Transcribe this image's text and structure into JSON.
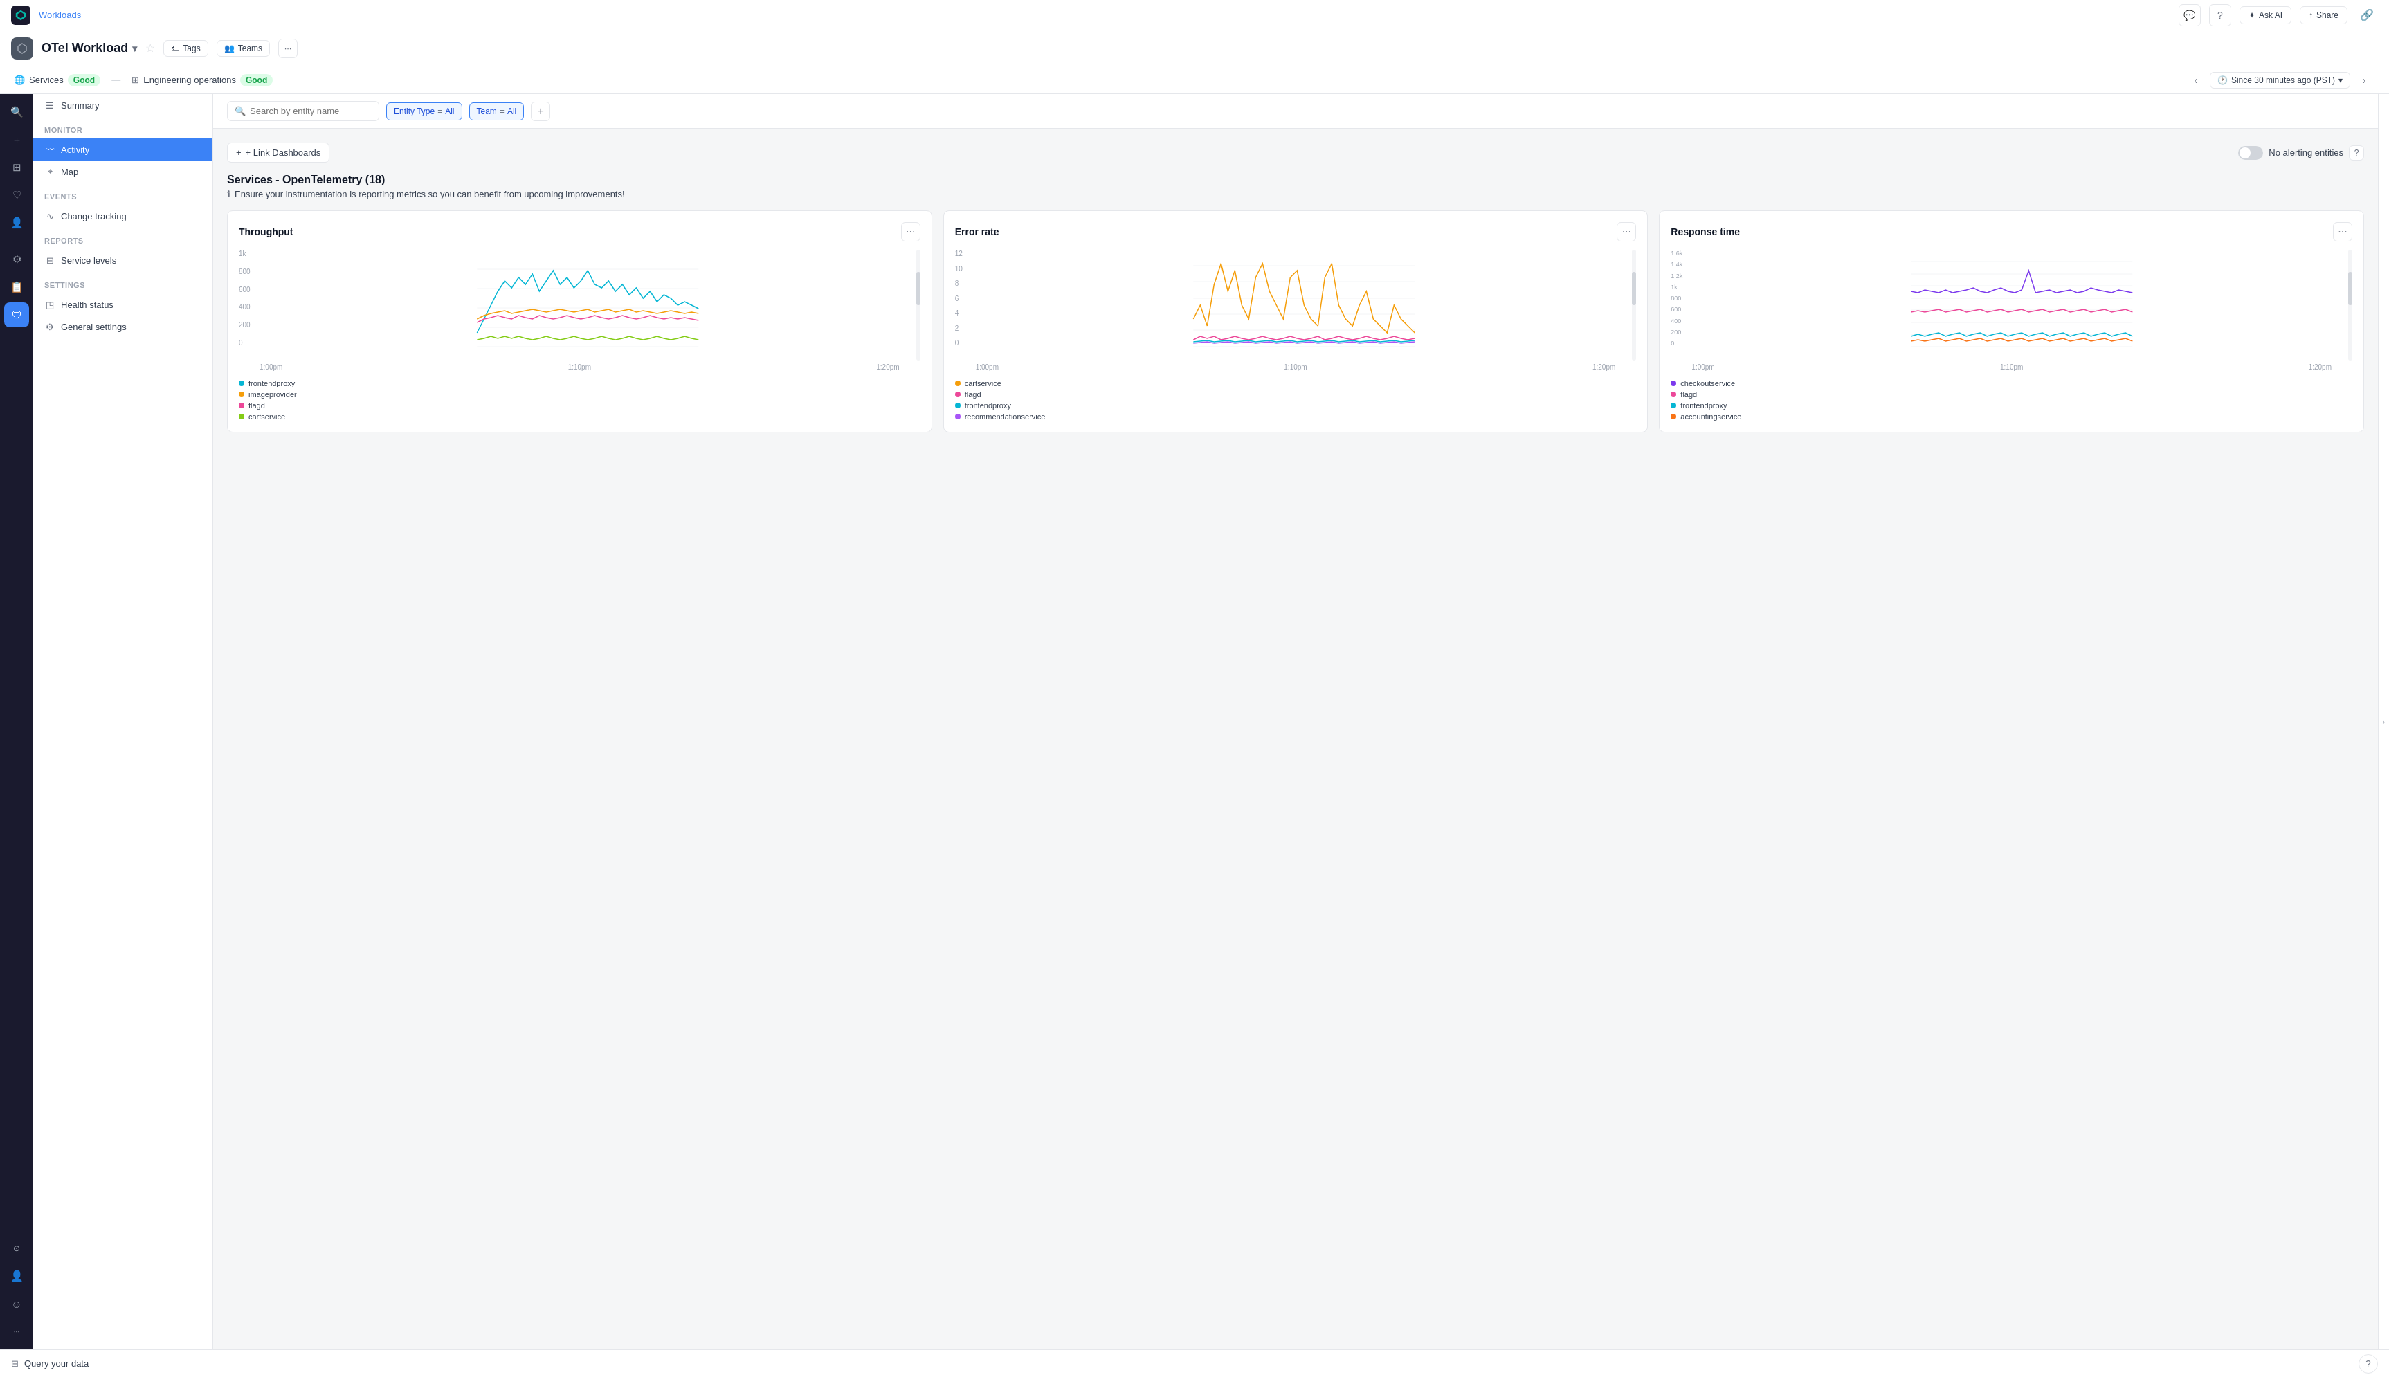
{
  "app": {
    "logo_alt": "New Relic",
    "workloads_label": "Workloads"
  },
  "topbar": {
    "chat_icon": "💬",
    "help_icon": "?",
    "ask_ai_label": "Ask AI",
    "share_label": "Share",
    "link_icon": "🔗"
  },
  "entity": {
    "name": "OTel Workload",
    "tags_label": "Tags",
    "teams_label": "Teams",
    "more_icon": "···"
  },
  "statusbar": {
    "services_label": "Services",
    "services_status": "Good",
    "engineering_ops_label": "Engineering operations",
    "engineering_ops_status": "Good",
    "time_label": "Since 30 minutes ago (PST)"
  },
  "sidebar": {
    "summary_label": "Summary",
    "monitor_section": "MONITOR",
    "activity_label": "Activity",
    "map_label": "Map",
    "events_section": "EVENTS",
    "change_tracking_label": "Change tracking",
    "reports_section": "REPORTS",
    "service_levels_label": "Service levels",
    "settings_section": "SETTINGS",
    "health_status_label": "Health status",
    "general_settings_label": "General settings"
  },
  "filters": {
    "search_placeholder": "Search by entity name",
    "entity_type_label": "Entity Type",
    "entity_type_eq": "=",
    "entity_type_value": "All",
    "team_label": "Team",
    "team_eq": "=",
    "team_value": "All",
    "add_icon": "+"
  },
  "link_dashboards": {
    "label": "+ Link Dashboards",
    "no_alerting_label": "No alerting entities",
    "help_icon": "?"
  },
  "section": {
    "title": "Services - OpenTelemetry (18)",
    "info_text": "Ensure your instrumentation is reporting metrics so you can benefit from upcoming improvements!"
  },
  "charts": {
    "throughput": {
      "title": "Throughput",
      "y_labels": [
        "1k",
        "800",
        "600",
        "400",
        "200",
        "0"
      ],
      "x_labels": [
        "1:00pm",
        "1:10pm",
        "1:20pm"
      ],
      "legend": [
        {
          "name": "frontendproxy",
          "color": "#06b6d4"
        },
        {
          "name": "imageprovider",
          "color": "#f59e0b"
        },
        {
          "name": "flagd",
          "color": "#ec4899"
        },
        {
          "name": "cartservice",
          "color": "#84cc16"
        }
      ]
    },
    "error_rate": {
      "title": "Error rate",
      "y_labels": [
        "12",
        "10",
        "8",
        "6",
        "4",
        "2",
        "0"
      ],
      "x_labels": [
        "1:00pm",
        "1:10pm",
        "1:20pm"
      ],
      "legend": [
        {
          "name": "cartservice",
          "color": "#f59e0b"
        },
        {
          "name": "flagd",
          "color": "#ec4899"
        },
        {
          "name": "frontendproxy",
          "color": "#06b6d4"
        },
        {
          "name": "recommendationservice",
          "color": "#a855f7"
        }
      ]
    },
    "response_time": {
      "title": "Response time",
      "y_labels": [
        "1.6k",
        "1.4k",
        "1.2k",
        "1k",
        "800",
        "600",
        "400",
        "200",
        "0"
      ],
      "x_labels": [
        "1:00pm",
        "1:10pm",
        "1:20pm"
      ],
      "legend": [
        {
          "name": "checkoutservice",
          "color": "#7c3aed"
        },
        {
          "name": "flagd",
          "color": "#ec4899"
        },
        {
          "name": "frontendproxy",
          "color": "#06b6d4"
        },
        {
          "name": "accountingservice",
          "color": "#f97316"
        }
      ]
    }
  },
  "bottom_bar": {
    "query_label": "Query your data",
    "help_icon": "?"
  },
  "left_strip_icons": [
    {
      "name": "search-icon",
      "symbol": "🔍"
    },
    {
      "name": "add-icon",
      "symbol": "+"
    },
    {
      "name": "grid-icon",
      "symbol": "⊞"
    },
    {
      "name": "heart-icon",
      "symbol": "♡"
    },
    {
      "name": "person-icon",
      "symbol": "👤"
    },
    {
      "name": "settings-icon",
      "symbol": "⚙"
    },
    {
      "name": "calendar-icon",
      "symbol": "📅"
    },
    {
      "name": "shield-active-icon",
      "symbol": "🛡"
    },
    {
      "name": "more-icon",
      "symbol": "···"
    }
  ]
}
